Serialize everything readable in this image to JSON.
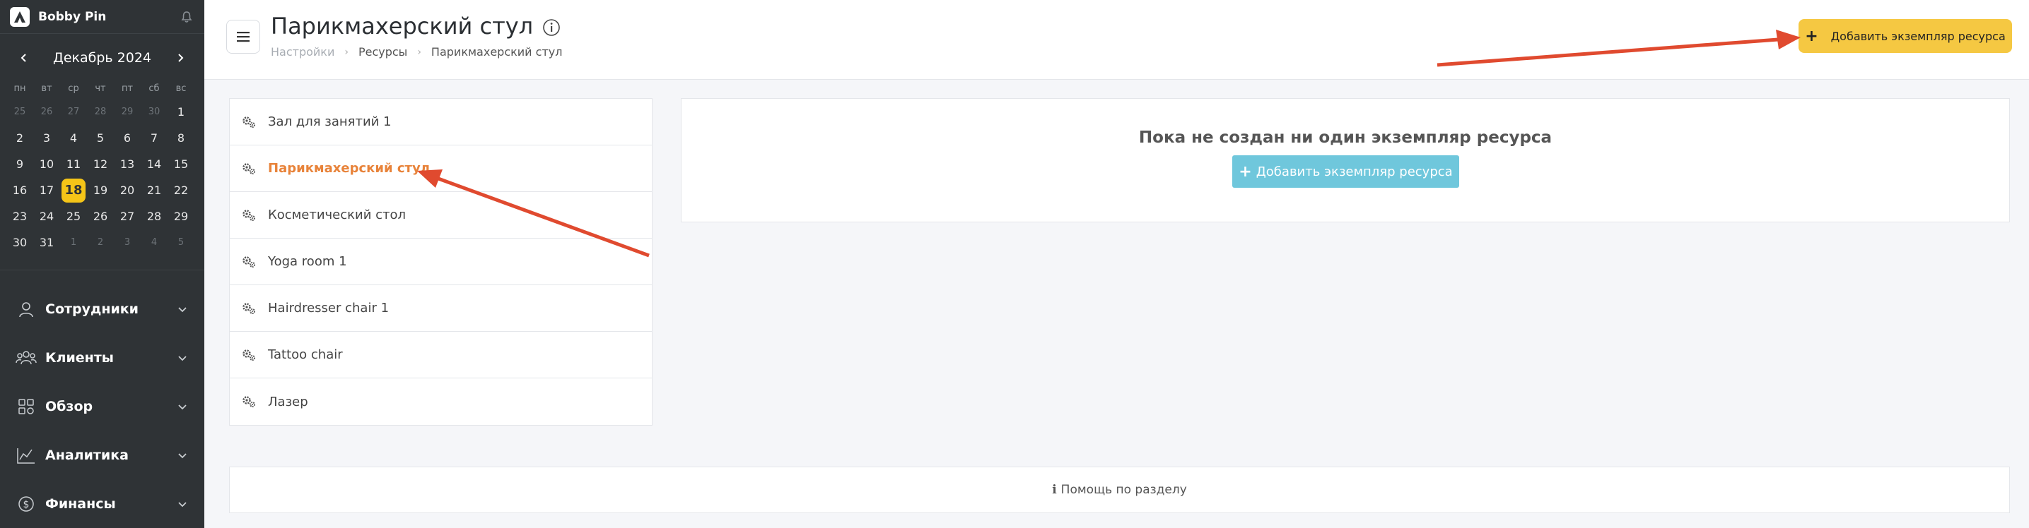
{
  "brand": {
    "name": "Bobby Pin"
  },
  "calendar": {
    "month_title": "Декабрь 2024",
    "weekdays": [
      "пн",
      "вт",
      "ср",
      "чт",
      "пт",
      "сб",
      "вс"
    ],
    "days": [
      {
        "d": "25",
        "m": true
      },
      {
        "d": "26",
        "m": true
      },
      {
        "d": "27",
        "m": true
      },
      {
        "d": "28",
        "m": true
      },
      {
        "d": "29",
        "m": true
      },
      {
        "d": "30",
        "m": true
      },
      {
        "d": "1",
        "m": false
      },
      {
        "d": "2",
        "m": false
      },
      {
        "d": "3",
        "m": false
      },
      {
        "d": "4",
        "m": false
      },
      {
        "d": "5",
        "m": false
      },
      {
        "d": "6",
        "m": false
      },
      {
        "d": "7",
        "m": false
      },
      {
        "d": "8",
        "m": false
      },
      {
        "d": "9",
        "m": false
      },
      {
        "d": "10",
        "m": false
      },
      {
        "d": "11",
        "m": false
      },
      {
        "d": "12",
        "m": false
      },
      {
        "d": "13",
        "m": false
      },
      {
        "d": "14",
        "m": false
      },
      {
        "d": "15",
        "m": false
      },
      {
        "d": "16",
        "m": false
      },
      {
        "d": "17",
        "m": false
      },
      {
        "d": "18",
        "m": false,
        "today": true
      },
      {
        "d": "19",
        "m": false
      },
      {
        "d": "20",
        "m": false
      },
      {
        "d": "21",
        "m": false
      },
      {
        "d": "22",
        "m": false
      },
      {
        "d": "23",
        "m": false
      },
      {
        "d": "24",
        "m": false
      },
      {
        "d": "25",
        "m": false
      },
      {
        "d": "26",
        "m": false
      },
      {
        "d": "27",
        "m": false
      },
      {
        "d": "28",
        "m": false
      },
      {
        "d": "29",
        "m": false
      },
      {
        "d": "30",
        "m": false
      },
      {
        "d": "31",
        "m": false
      },
      {
        "d": "1",
        "m": true
      },
      {
        "d": "2",
        "m": true
      },
      {
        "d": "3",
        "m": true
      },
      {
        "d": "4",
        "m": true
      },
      {
        "d": "5",
        "m": true
      }
    ]
  },
  "nav": [
    {
      "label": "Сотрудники",
      "icon": "user-icon"
    },
    {
      "label": "Клиенты",
      "icon": "users-icon"
    },
    {
      "label": "Обзор",
      "icon": "grid-icon"
    },
    {
      "label": "Аналитика",
      "icon": "analytics-icon"
    },
    {
      "label": "Финансы",
      "icon": "dollar-icon"
    }
  ],
  "header": {
    "title": "Парикмахерский стул",
    "breadcrumb": [
      "Настройки",
      "Ресурсы",
      "Парикмахерский стул"
    ],
    "add_button_label": "Добавить экземпляр ресурса"
  },
  "resources": [
    {
      "label": "Зал для занятий 1",
      "active": false
    },
    {
      "label": "Парикмахерский стул",
      "active": true
    },
    {
      "label": "Косметический стол",
      "active": false
    },
    {
      "label": "Yoga room 1",
      "active": false
    },
    {
      "label": "Hairdresser chair 1",
      "active": false
    },
    {
      "label": "Tattoo chair",
      "active": false
    },
    {
      "label": "Лазер",
      "active": false
    }
  ],
  "empty_state": {
    "message": "Пока не создан ни один экземпляр ресурса",
    "button_label": "Добавить экземпляр ресурса"
  },
  "help": {
    "label": "Помощь по разделу"
  },
  "colors": {
    "accent_yellow": "#f5c842",
    "active_orange": "#e8833a",
    "button_blue": "#6fc7dc",
    "arrow_red": "#e04a2f",
    "sidebar_bg": "#2f3336"
  }
}
